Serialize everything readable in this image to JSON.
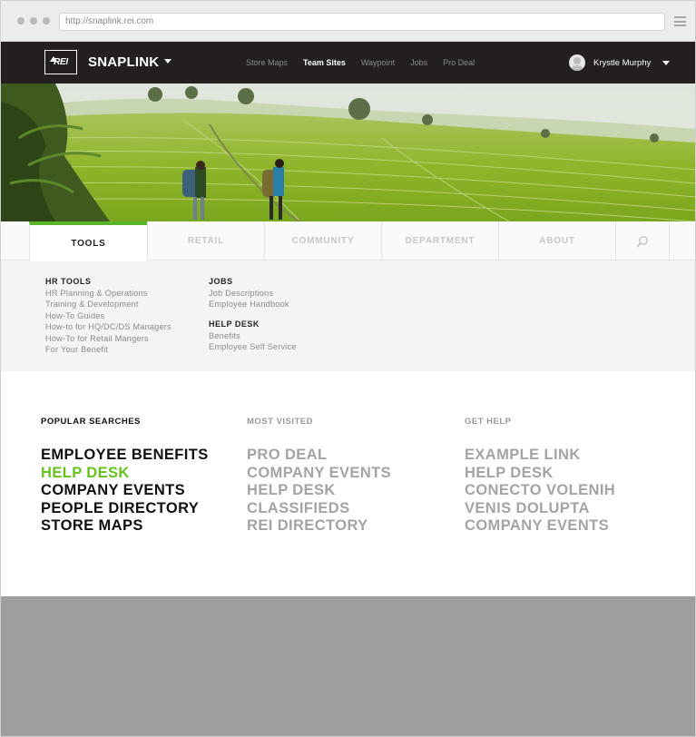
{
  "browser": {
    "url": "http://snaplink.rei.com"
  },
  "nav": {
    "logo_text": "REI",
    "brand": "SNAPLINK",
    "links": [
      {
        "label": "Store Maps"
      },
      {
        "label": "Team Sites",
        "active": true
      },
      {
        "label": "Waypoint"
      },
      {
        "label": "Jobs"
      },
      {
        "label": "Pro Deal"
      }
    ],
    "user_name": "Krystle Murphy"
  },
  "tabs": [
    {
      "label": "TOOLS",
      "active": true
    },
    {
      "label": "RETAIL"
    },
    {
      "label": "COMMUNITY"
    },
    {
      "label": "DEPARTMENT"
    },
    {
      "label": "ABOUT"
    }
  ],
  "dropdown": {
    "hr_tools": {
      "title": "HR TOOLS",
      "items": [
        "HR Planning & Operations",
        "Training & Development",
        "How-To Guides",
        "How-to for HQ/DC/DS Managers",
        "How-To for Retail Mangers",
        "For Your Benefit"
      ]
    },
    "jobs": {
      "title": "JOBS",
      "items": [
        "Job Descriptions",
        "Employee Handbook"
      ]
    },
    "help_desk": {
      "title": "HELP DESK",
      "items": [
        "Benefits",
        "Employee Self Service"
      ]
    }
  },
  "popular": {
    "title": "POPULAR SEARCHES",
    "items": [
      "EMPLOYEE BENEFITS",
      "HELP DESK",
      "COMPANY EVENTS",
      "PEOPLE DIRECTORY",
      "STORE MAPS"
    ]
  },
  "most_visited": {
    "title": "MOST VISITED",
    "items": [
      "PRO DEAL",
      "COMPANY EVENTS",
      "HELP DESK",
      "CLASSIFIEDS",
      "REI DIRECTORY"
    ]
  },
  "get_help": {
    "title": "GET HELP",
    "items": [
      "EXAMPLE LINK",
      "HELP DESK",
      "CONECTO VOLENIH",
      "VENIS DOLUPTA",
      "COMPANY EVENTS"
    ]
  },
  "colors": {
    "nav_bg": "#231f20",
    "accent_green": "#66c21d",
    "tab_underline": "#5bb32c",
    "footer_gray": "#9e9e9e"
  }
}
